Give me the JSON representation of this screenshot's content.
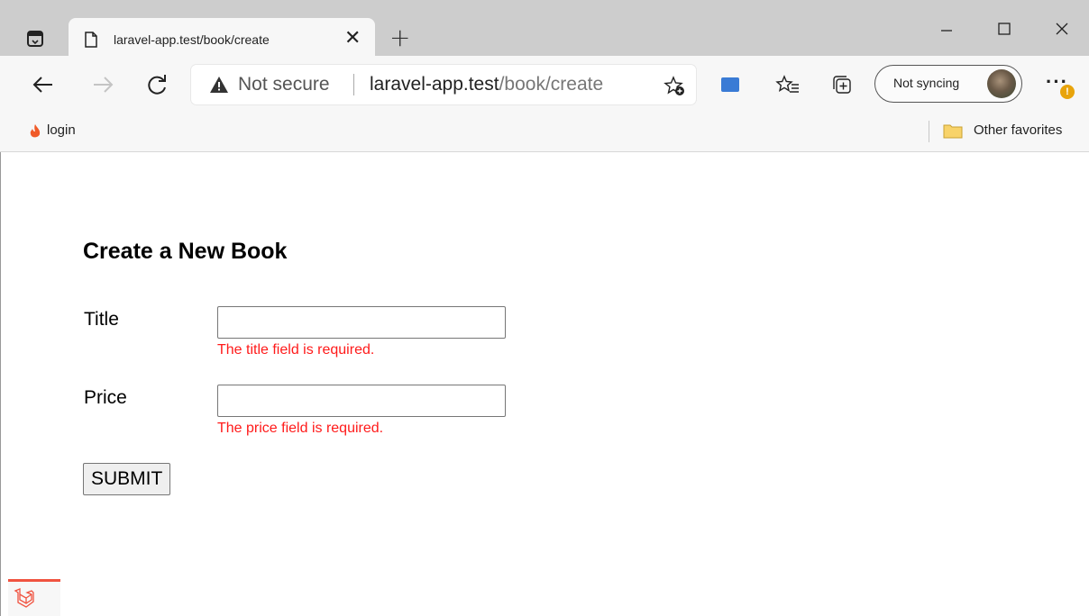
{
  "browser": {
    "tab": {
      "title": "laravel-app.test/book/create",
      "close": "✕"
    },
    "new_tab": "+",
    "window": {
      "minimize": "—",
      "maximize": "☐",
      "close": "✕"
    },
    "address": {
      "security_label": "Not secure",
      "host": "laravel-app.test",
      "path": "/book/create"
    },
    "sync": {
      "label": "Not syncing"
    },
    "more": "···",
    "badge": "!",
    "favorites": {
      "items": [
        {
          "label": "login",
          "icon": "flame-icon"
        }
      ],
      "other_label": "Other favorites"
    }
  },
  "page": {
    "heading": "Create a New Book",
    "fields": {
      "title": {
        "label": "Title",
        "value": "",
        "error": "The title field is required."
      },
      "price": {
        "label": "Price",
        "value": "",
        "error": "The price field is required."
      }
    },
    "submit_label": "SUBMIT"
  },
  "colors": {
    "error": "#ff1a1a",
    "tabbar": "#cdcdcd",
    "toolbar": "#f7f7f7",
    "laravel": "#f05340"
  }
}
